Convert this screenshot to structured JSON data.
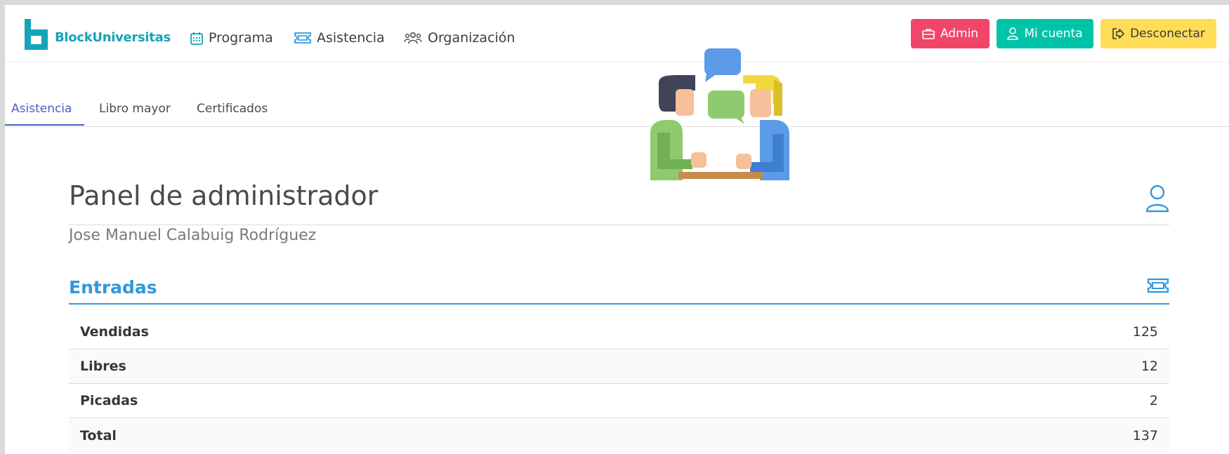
{
  "brand": {
    "name": "BlockUniversitas"
  },
  "nav": {
    "items": [
      {
        "label": "Programa",
        "icon": "calendar-icon"
      },
      {
        "label": "Asistencia",
        "icon": "ticket-icon"
      },
      {
        "label": "Organización",
        "icon": "users-icon"
      }
    ],
    "buttons": {
      "admin": "Admin",
      "account": "Mi cuenta",
      "logout": "Desconectar"
    }
  },
  "tabs": [
    {
      "label": "Asistencia",
      "active": true
    },
    {
      "label": "Libro mayor",
      "active": false
    },
    {
      "label": "Certificados",
      "active": false
    }
  ],
  "main": {
    "title": "Panel de administrador",
    "subtitle": "Jose Manuel Calabuig Rodríguez",
    "section_title": "Entradas",
    "stats": [
      {
        "label": "Vendidas",
        "value": "125"
      },
      {
        "label": "Libres",
        "value": "12"
      },
      {
        "label": "Picadas",
        "value": "2"
      },
      {
        "label": "Total",
        "value": "137"
      }
    ]
  },
  "colors": {
    "brand": "#16a3b8",
    "danger": "#f14668",
    "primary": "#00c4a7",
    "warning": "#ffdd57",
    "info": "#3298dc",
    "link": "#485fc7"
  }
}
